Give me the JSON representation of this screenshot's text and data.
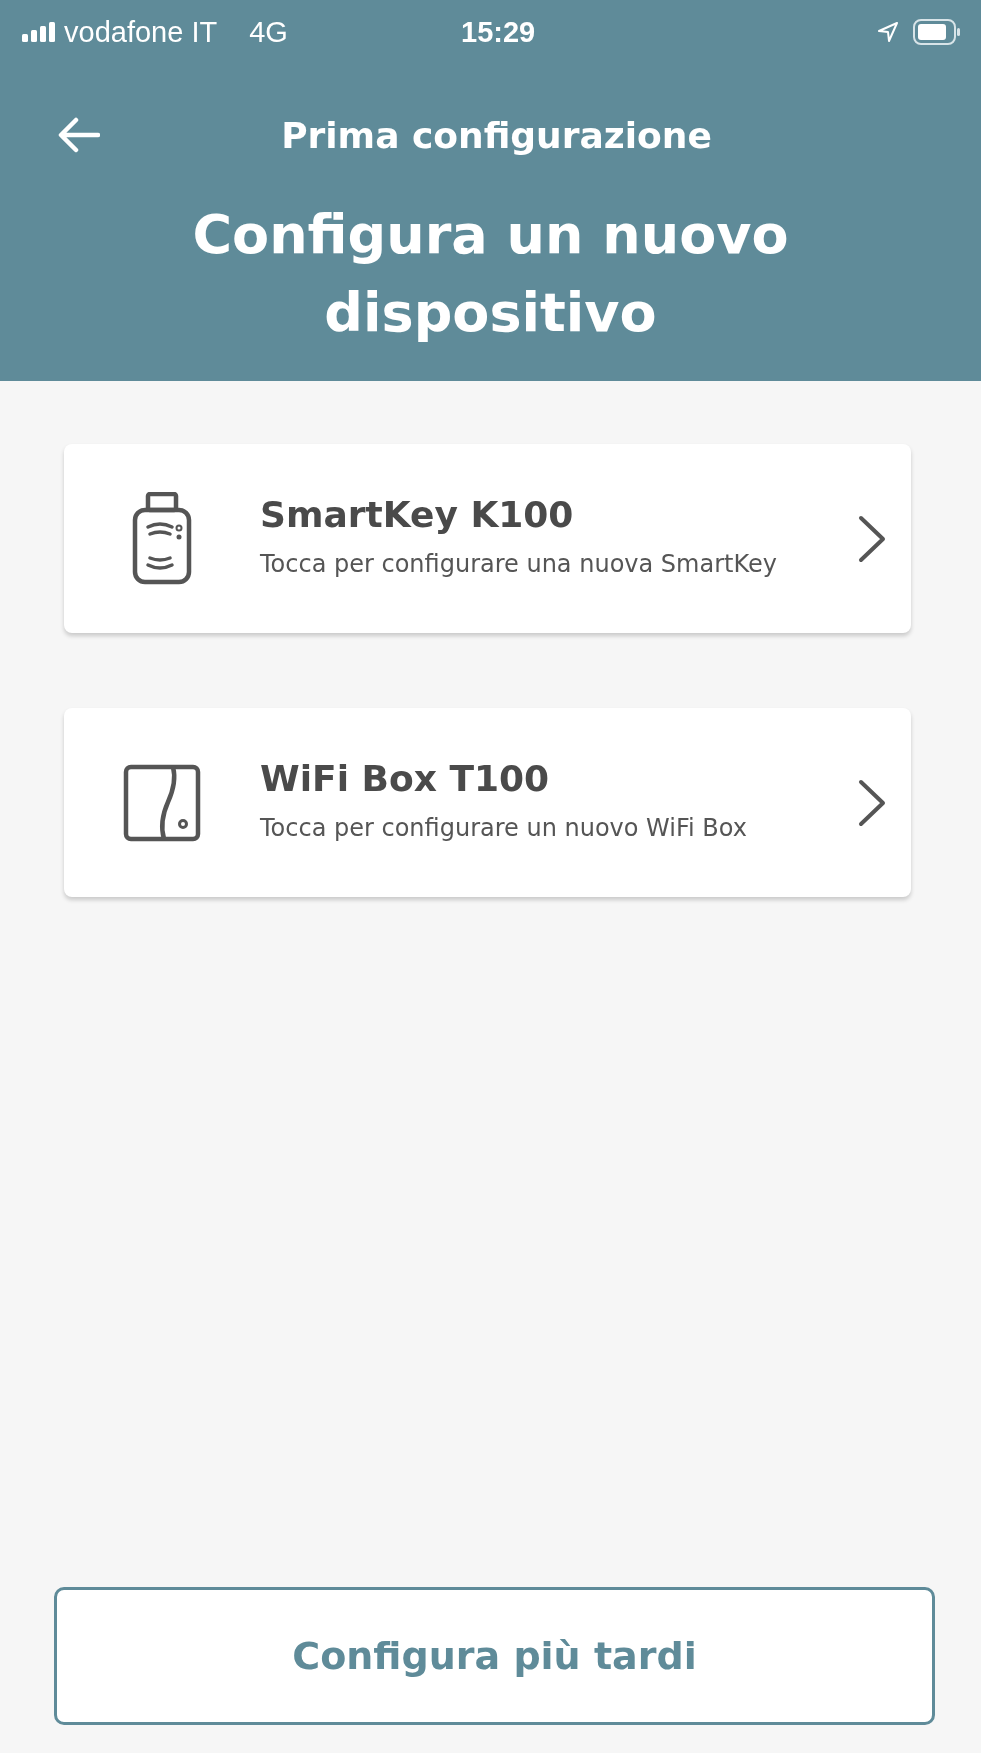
{
  "status_bar": {
    "carrier": "vodafone IT",
    "network": "4G",
    "time": "15:29"
  },
  "nav": {
    "title": "Prima configurazione"
  },
  "heading": "Configura un nuovo dispositivo",
  "devices": [
    {
      "kind": "key",
      "name": "SmartKey K100",
      "description": "Tocca per configurare una nuova SmartKey"
    },
    {
      "kind": "box",
      "name": "WiFi Box T100",
      "description": "Tocca per configurare un nuovo WiFi Box"
    }
  ],
  "later_button": "Configura più tardi"
}
